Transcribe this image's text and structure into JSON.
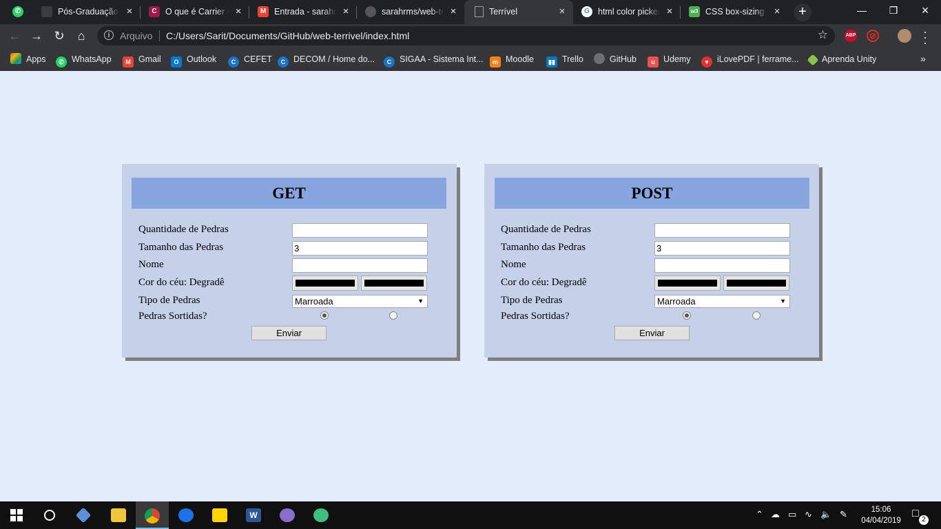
{
  "browser": {
    "tabs": [
      {
        "title": "",
        "icon": "whatsapp-icon",
        "color": "#25d366"
      },
      {
        "title": "Pós-Graduação La",
        "icon": "page-icon",
        "color": "#3c3c3c"
      },
      {
        "title": "O que é Carrier Et",
        "icon": "c-logo-icon",
        "color": "#a0174c"
      },
      {
        "title": "Entrada - sarahro",
        "icon": "gmail-icon",
        "color": "#ea4335"
      },
      {
        "title": "sarahrms/web-ter",
        "icon": "github-icon",
        "color": "#555555"
      },
      {
        "title": "Terrível",
        "icon": "page-icon",
        "color": "#9aa0a6",
        "active": true
      },
      {
        "title": "html color picker",
        "icon": "google-icon",
        "color": "#4285f4"
      },
      {
        "title": "CSS box-sizing pr",
        "icon": "w3schools-icon",
        "color": "#4caf50"
      }
    ],
    "omnibox": {
      "scheme": "Arquivo",
      "url": "C:/Users/Sarit/Documents/GitHub/web-terrivel/index.html"
    },
    "extensions": [
      {
        "label": "ABP",
        "icon": "adblock-plus-icon",
        "color": "#c70d2c"
      },
      {
        "label": "",
        "icon": "blocked-icon",
        "color": "#d93025"
      }
    ],
    "bookmarks": [
      {
        "label": "Apps",
        "icon": "apps-grid-icon",
        "color": "#e0624a"
      },
      {
        "label": "WhatsApp",
        "icon": "whatsapp-icon",
        "color": "#25d366"
      },
      {
        "label": "Gmail",
        "icon": "gmail-icon",
        "color": "#ea4335"
      },
      {
        "label": "Outlook",
        "icon": "outlook-icon",
        "color": "#0078d4"
      },
      {
        "label": "CEFET",
        "icon": "cefet-icon",
        "color": "#1a73c7"
      },
      {
        "label": "DECOM / Home do...",
        "icon": "decom-icon",
        "color": "#1a73c7"
      },
      {
        "label": "SIGAA - Sistema Int...",
        "icon": "sigaa-icon",
        "color": "#1a73c7"
      },
      {
        "label": "Moodle",
        "icon": "moodle-icon",
        "color": "#f98012"
      },
      {
        "label": "Trello",
        "icon": "trello-icon",
        "color": "#0079bf"
      },
      {
        "label": "GitHub",
        "icon": "github-icon",
        "color": "#6e6e6e"
      },
      {
        "label": "Udemy",
        "icon": "udemy-icon",
        "color": "#ec5252"
      },
      {
        "label": "iLovePDF | ferrame...",
        "icon": "ilovepdf-icon",
        "color": "#e5322d"
      },
      {
        "label": "Aprenda Unity",
        "icon": "unity-icon",
        "color": "#8bc34a"
      }
    ]
  },
  "forms": [
    {
      "heading": "GET",
      "labels": {
        "quantity": "Quantidade de Pedras",
        "size": "Tamanho das Pedras",
        "name": "Nome",
        "sky": "Cor do céu: Degradê",
        "type": "Tipo de Pedras",
        "assorted": "Pedras Sortidas?"
      },
      "values": {
        "quantity": "",
        "size": "3",
        "name": ""
      },
      "sky_colors": [
        "#000000",
        "#000000"
      ],
      "stone_type": "Marroada",
      "assorted_selected": "first",
      "submit": "Enviar"
    },
    {
      "heading": "POST",
      "labels": {
        "quantity": "Quantidade de Pedras",
        "size": "Tamanho das Pedras",
        "name": "Nome",
        "sky": "Cor do céu: Degradê",
        "type": "Tipo de Pedras",
        "assorted": "Pedras Sortidas?"
      },
      "values": {
        "quantity": "",
        "size": "3",
        "name": ""
      },
      "sky_colors": [
        "#000000",
        "#000000"
      ],
      "stone_type": "Marroada",
      "assorted_selected": "first",
      "submit": "Enviar"
    }
  ],
  "taskbar": {
    "apps": [
      {
        "icon": "windows-start-icon",
        "color": "#ffffff"
      },
      {
        "icon": "cortana-circle-icon",
        "color": "#ffffff"
      },
      {
        "icon": "virtualbox-icon",
        "color": "#5b8fd8"
      },
      {
        "icon": "file-explorer-icon",
        "color": "#f3c53a"
      },
      {
        "icon": "chrome-icon",
        "color": "#4285f4",
        "active": true
      },
      {
        "icon": "maps-pin-icon",
        "color": "#1a73e8"
      },
      {
        "icon": "sticky-notes-icon",
        "color": "#ffd400"
      },
      {
        "icon": "word-icon",
        "color": "#2b5797"
      },
      {
        "icon": "github-desktop-icon",
        "color": "#8a6ecf"
      },
      {
        "icon": "atom-icon",
        "color": "#3fbf7f"
      }
    ],
    "time": "15:06",
    "date": "04/04/2019",
    "notifications": "2"
  }
}
